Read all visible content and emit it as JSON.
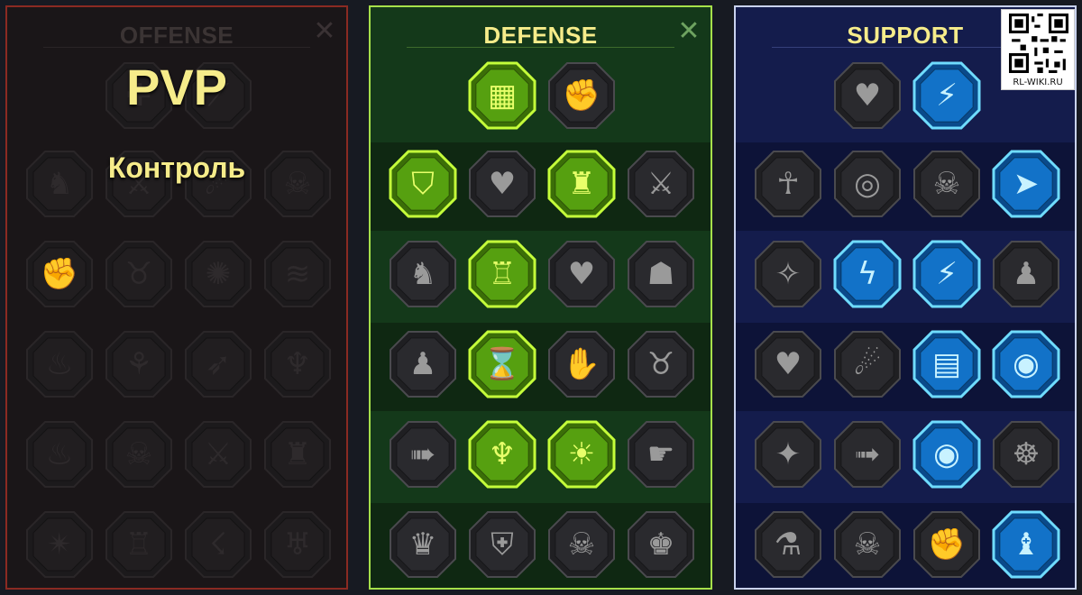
{
  "colors": {
    "offense_bg": "#1a1618",
    "defense_bg": "#14391a",
    "support_bg": "#141c4c",
    "title": "#f6ec8a",
    "green_active": "#a6f01e",
    "blue_active": "#38b8f0"
  },
  "overlay": {
    "mode": "PVP",
    "submode": "Контроль"
  },
  "watermark": {
    "label": "RL-WIKI.RU"
  },
  "panels": {
    "offense": {
      "title": "OFFENSE",
      "close": "✕",
      "nodes": [
        {
          "row": 0,
          "col": 1,
          "icon": "plus-icon",
          "active": false
        },
        {
          "row": 0,
          "col": 2,
          "icon": "slash-icon",
          "active": false
        },
        {
          "row": 1,
          "col": 0,
          "icon": "warrior-icon",
          "active": false
        },
        {
          "row": 1,
          "col": 1,
          "icon": "blade-icon",
          "active": false
        },
        {
          "row": 1,
          "col": 2,
          "icon": "claw-icon",
          "active": false
        },
        {
          "row": 1,
          "col": 3,
          "icon": "skull-icon",
          "active": false
        },
        {
          "row": 2,
          "col": 0,
          "icon": "fist-icon",
          "active": false
        },
        {
          "row": 2,
          "col": 1,
          "icon": "demon-icon",
          "active": false
        },
        {
          "row": 2,
          "col": 2,
          "icon": "swirl-icon",
          "active": false
        },
        {
          "row": 2,
          "col": 3,
          "icon": "wave-icon",
          "active": false
        },
        {
          "row": 3,
          "col": 0,
          "icon": "flame-icon",
          "active": false
        },
        {
          "row": 3,
          "col": 1,
          "icon": "rune-icon",
          "active": false
        },
        {
          "row": 3,
          "col": 2,
          "icon": "arrow-icon",
          "active": false
        },
        {
          "row": 3,
          "col": 3,
          "icon": "beast-icon",
          "active": false
        },
        {
          "row": 4,
          "col": 0,
          "icon": "fire-icon",
          "active": false
        },
        {
          "row": 4,
          "col": 1,
          "icon": "skull-icon",
          "active": false
        },
        {
          "row": 4,
          "col": 2,
          "icon": "sword-icon",
          "active": false
        },
        {
          "row": 4,
          "col": 3,
          "icon": "titan-icon",
          "active": false
        },
        {
          "row": 5,
          "col": 0,
          "icon": "spark-icon",
          "active": false
        },
        {
          "row": 5,
          "col": 1,
          "icon": "helm-icon",
          "active": false
        },
        {
          "row": 5,
          "col": 2,
          "icon": "storm-icon",
          "active": false
        },
        {
          "row": 5,
          "col": 3,
          "icon": "horned-icon",
          "active": false
        }
      ]
    },
    "defense": {
      "title": "DEFENSE",
      "close": "✕",
      "nodes": [
        {
          "row": 0,
          "col": 1,
          "icon": "bricks-icon",
          "active": true
        },
        {
          "row": 0,
          "col": 2,
          "icon": "fist-icon",
          "active": false
        },
        {
          "row": 1,
          "col": 0,
          "icon": "shield-icon",
          "active": true
        },
        {
          "row": 1,
          "col": 1,
          "icon": "heart-armor-icon",
          "active": false
        },
        {
          "row": 1,
          "col": 2,
          "icon": "golem-icon",
          "active": true
        },
        {
          "row": 1,
          "col": 3,
          "icon": "crossed-blades-icon",
          "active": false
        },
        {
          "row": 2,
          "col": 0,
          "icon": "duelist-icon",
          "active": false
        },
        {
          "row": 2,
          "col": 1,
          "icon": "knight-icon",
          "active": true
        },
        {
          "row": 2,
          "col": 2,
          "icon": "heart-skull-icon",
          "active": false
        },
        {
          "row": 2,
          "col": 3,
          "icon": "hooded-icon",
          "active": false
        },
        {
          "row": 3,
          "col": 0,
          "icon": "crowd-icon",
          "active": false
        },
        {
          "row": 3,
          "col": 1,
          "icon": "hourglass-icon",
          "active": true
        },
        {
          "row": 3,
          "col": 2,
          "icon": "hand-icon",
          "active": false
        },
        {
          "row": 3,
          "col": 3,
          "icon": "bull-icon",
          "active": false
        },
        {
          "row": 4,
          "col": 0,
          "icon": "dash-icon",
          "active": false
        },
        {
          "row": 4,
          "col": 1,
          "icon": "drops-icon",
          "active": true
        },
        {
          "row": 4,
          "col": 2,
          "icon": "skull-sun-icon",
          "active": true
        },
        {
          "row": 4,
          "col": 3,
          "icon": "grab-icon",
          "active": false
        },
        {
          "row": 5,
          "col": 0,
          "icon": "berserker-icon",
          "active": false
        },
        {
          "row": 5,
          "col": 1,
          "icon": "winged-shield-icon",
          "active": false
        },
        {
          "row": 5,
          "col": 2,
          "icon": "brute-icon",
          "active": false
        },
        {
          "row": 5,
          "col": 3,
          "icon": "flex-icon",
          "active": false
        }
      ]
    },
    "support": {
      "title": "SUPPORT",
      "nodes": [
        {
          "row": 0,
          "col": 1,
          "icon": "heart-plus-icon",
          "active": false
        },
        {
          "row": 0,
          "col": 2,
          "icon": "tether-icon",
          "active": true
        },
        {
          "row": 1,
          "col": 0,
          "icon": "praying-hands-icon",
          "active": false
        },
        {
          "row": 1,
          "col": 1,
          "icon": "aura-shield-icon",
          "active": false
        },
        {
          "row": 1,
          "col": 2,
          "icon": "smoke-skull-icon",
          "active": false
        },
        {
          "row": 1,
          "col": 3,
          "icon": "rush-icon",
          "active": true
        },
        {
          "row": 2,
          "col": 0,
          "icon": "blessing-icon",
          "active": false
        },
        {
          "row": 2,
          "col": 1,
          "icon": "lightning-icon",
          "active": true
        },
        {
          "row": 2,
          "col": 2,
          "icon": "rift-icon",
          "active": true
        },
        {
          "row": 2,
          "col": 3,
          "icon": "shadows-icon",
          "active": false
        },
        {
          "row": 3,
          "col": 0,
          "icon": "chained-heart-icon",
          "active": false
        },
        {
          "row": 3,
          "col": 1,
          "icon": "comet-icon",
          "active": false
        },
        {
          "row": 3,
          "col": 2,
          "icon": "book-icon",
          "active": true
        },
        {
          "row": 3,
          "col": 3,
          "icon": "eyes-icon",
          "active": true
        },
        {
          "row": 4,
          "col": 0,
          "icon": "compass-icon",
          "active": false
        },
        {
          "row": 4,
          "col": 1,
          "icon": "swift-foot-icon",
          "active": false
        },
        {
          "row": 4,
          "col": 2,
          "icon": "eye-icon",
          "active": true
        },
        {
          "row": 4,
          "col": 3,
          "icon": "ninja-icon",
          "active": false
        },
        {
          "row": 5,
          "col": 0,
          "icon": "potion-icon",
          "active": false
        },
        {
          "row": 5,
          "col": 1,
          "icon": "skull-wing-icon",
          "active": false
        },
        {
          "row": 5,
          "col": 2,
          "icon": "fist-up-icon",
          "active": false
        },
        {
          "row": 5,
          "col": 3,
          "icon": "eagle-icon",
          "active": true
        }
      ]
    }
  }
}
